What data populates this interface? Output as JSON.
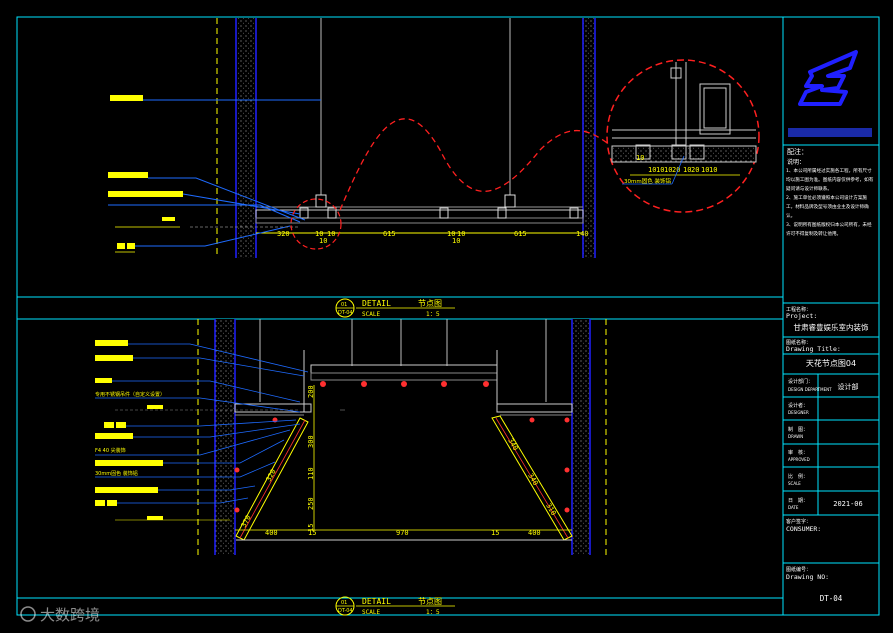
{
  "colors": {
    "background": "#000000",
    "frame": "#00e5ff",
    "wall": "#2020ff",
    "dimension": "#ffff00",
    "leader": "#1e6bff",
    "revision_cloud": "#ff2020",
    "titleblock_text": "#ffffff",
    "fixture": "#ff3030"
  },
  "top_detail": {
    "dimensions": [
      "320",
      "10",
      "615",
      "10",
      "615",
      "10",
      "10",
      "10",
      "10",
      "140"
    ],
    "zoom_dims": [
      "10",
      "10",
      "10",
      "20",
      "10",
      "20",
      "10",
      "10",
      "10"
    ],
    "zoom_note": "30mm固色 装饰铝"
  },
  "bottom_detail": {
    "dims_horizontal": [
      "400",
      "15",
      "970",
      "15",
      "400"
    ],
    "dims_vertical_left": [
      "200",
      "300",
      "110",
      "250",
      "15"
    ],
    "dims_slanted_left": [
      "320",
      "370"
    ],
    "dims_slanted_right": [
      "340",
      "340",
      "310"
    ],
    "note_1": "专用不锈钢吊件（自定义设置）",
    "note_2": "F4 40 尖装饰",
    "note_3": "30mm固色 装饰铝"
  },
  "detail_tags": [
    {
      "num": "01",
      "sheet": "DT-04",
      "title_en": "DETAIL",
      "title_cn": "节点图",
      "scale_label": "SCALE",
      "scale": "1：5"
    },
    {
      "num": "01",
      "sheet": "DT-04",
      "title_en": "DETAIL",
      "title_cn": "节点图",
      "scale_label": "SCALE",
      "scale": "1：5"
    }
  ],
  "titleblock": {
    "notes_heading": "配注：",
    "notes_sub": "说明：",
    "notes": [
      "1、本公司所属经过实施各工程，所有尺寸均以施工图为准。图纸内容仅供参考，如有疑问请与设计师联系。",
      "2、施工单位必须遵照本公司设计方案施工，材料品牌及型号须由业主及设计师确认。",
      "3、说明所有图纸版权归本公司所有，未经许可不得复制及转让他用。"
    ],
    "project_label_cn": "工程名称：",
    "project_label_en": "Project:",
    "project_name": "甘肃睿豊娱乐室内装饰",
    "drawing_title_label_cn": "图纸名称：",
    "drawing_title_label_en": "Drawing Title:",
    "drawing_title": "天花节点图04",
    "rows": [
      {
        "label_cn": "设计部门：",
        "label_en": "DESIGN DEPARTMENT",
        "value": "设计部"
      },
      {
        "label_cn": "设计者：",
        "label_en": "DESIGNER",
        "value": ""
      },
      {
        "label_cn": "制　图：",
        "label_en": "DRAWN",
        "value": ""
      },
      {
        "label_cn": "审　核：",
        "label_en": "APPROVED",
        "value": ""
      },
      {
        "label_cn": "比　例：",
        "label_en": "SCALE",
        "value": ""
      },
      {
        "label_cn": "日　期：",
        "label_en": "DATE",
        "value": "2021-06"
      }
    ],
    "consumer_label_cn": "客户签字：",
    "consumer_label_en": "CONSUMER:",
    "drawing_no_label_cn": "图纸编号：",
    "drawing_no_label_en": "Drawing NO:",
    "drawing_no": "DT-04"
  },
  "watermark": "大数跨境"
}
